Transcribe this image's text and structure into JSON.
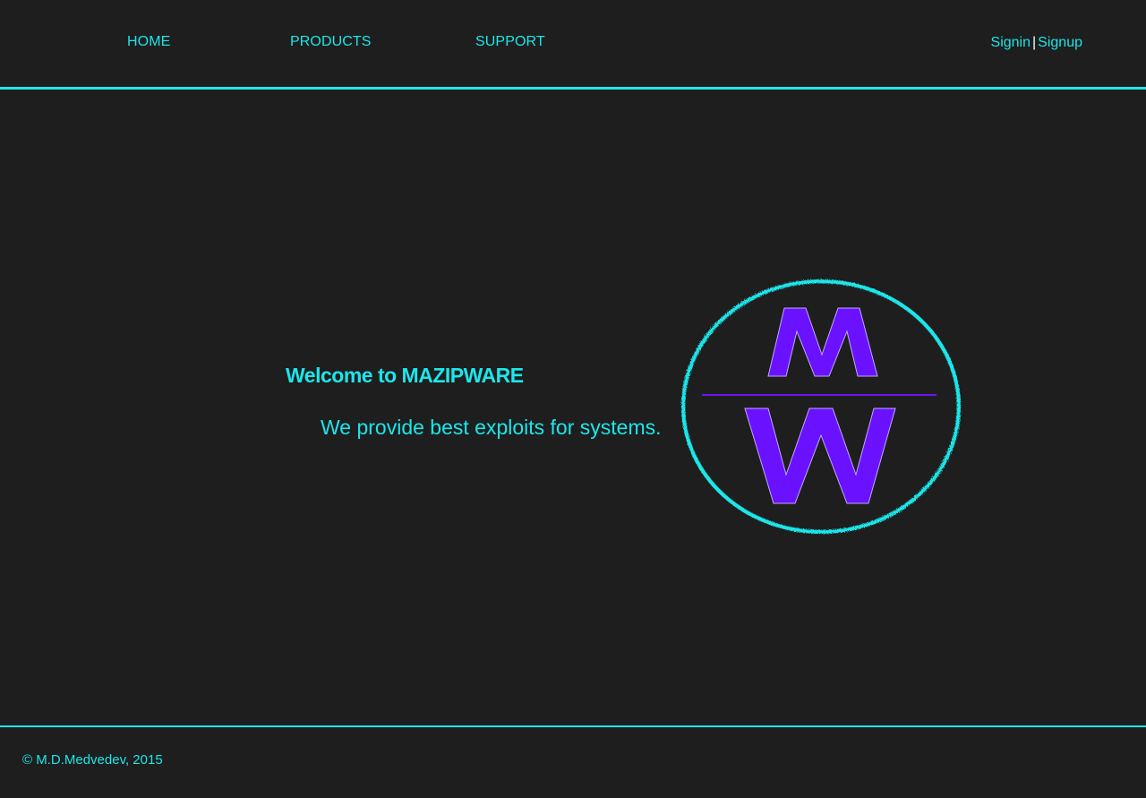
{
  "nav": {
    "home": "HOME",
    "products": "PRODUCTS",
    "support": "SUPPORT"
  },
  "auth": {
    "signin": "Signin",
    "separator": "|",
    "signup": "Signup"
  },
  "hero": {
    "welcome": "Welcome to MAZIPWARE",
    "tagline": "We provide best exploits for systems."
  },
  "logo": {
    "top_letter": "M",
    "bottom_letter": "W",
    "icon": "mw-logo-icon"
  },
  "footer": {
    "copyright": "© M.D.Medvedev, 2015"
  },
  "colors": {
    "background": "#1e1e1e",
    "accent": "#1ce6ea",
    "logo_purple": "#6a12ff",
    "separator": "#ffffff"
  }
}
